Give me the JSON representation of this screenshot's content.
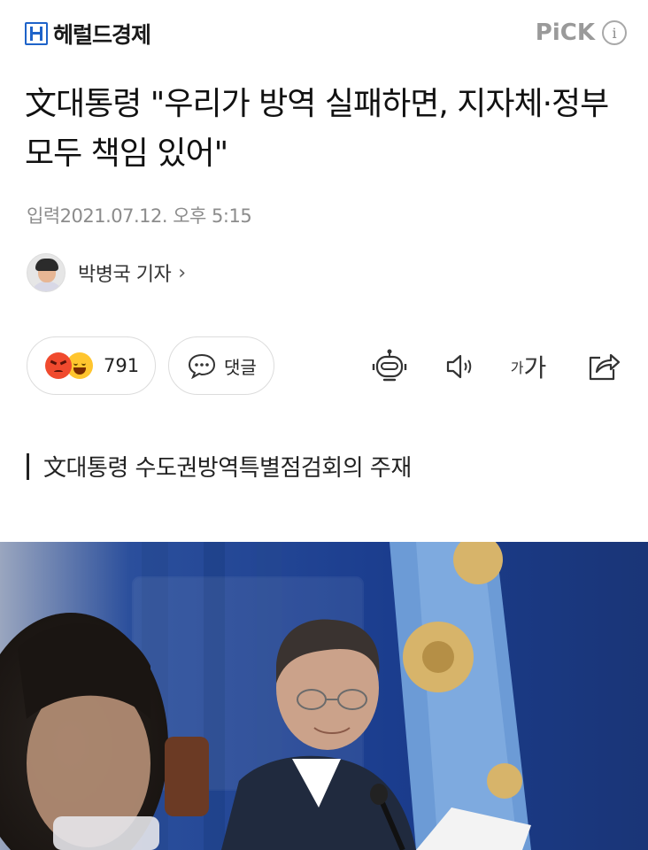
{
  "header": {
    "brand_name": "헤럴드경제",
    "pick_label": "PiCK",
    "info_icon": "i"
  },
  "article": {
    "headline": "文대통령 \"우리가 방역 실패하면, 지자체·정부 모두 책임 있어\"",
    "date_text": "입력2021.07.12. 오후 5:15",
    "reporter_name": "박병국 기자",
    "reporter_chevron": "›"
  },
  "actions": {
    "reaction_count": "791",
    "comment_label": "댓글",
    "font_small": "가",
    "font_large": "가"
  },
  "photo": {
    "caption": "文대통령 수도권방역특별점검회의 주재"
  },
  "colors": {
    "brand_blue": "#1e63c9",
    "pick_gray": "#9a9a9a",
    "angry_red": "#f04a2e",
    "laugh_yellow": "#ffc52e"
  }
}
